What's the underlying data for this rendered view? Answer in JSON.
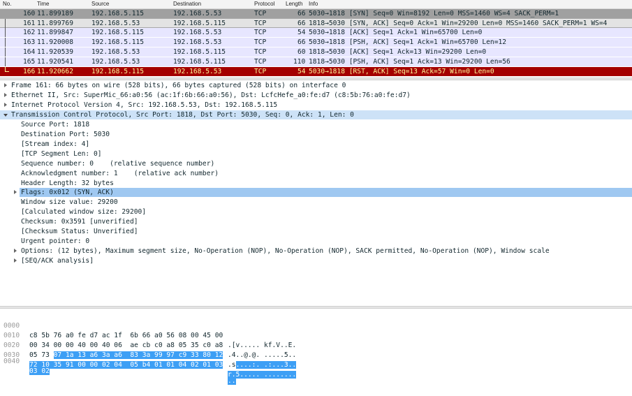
{
  "packet_list": {
    "columns": [
      "No.",
      "Time",
      "Source",
      "Destination",
      "Protocol",
      "Length",
      "Info"
    ],
    "rows": [
      {
        "no": "160",
        "time": "11.899189",
        "src": "192.168.5.115",
        "dst": "192.168.5.53",
        "proto": "TCP",
        "len": "66",
        "info": "5030→1818 [SYN] Seq=0 Win=8192 Len=0 MSS=1460 WS=4 SACK_PERM=1"
      },
      {
        "no": "161",
        "time": "11.899769",
        "src": "192.168.5.53",
        "dst": "192.168.5.115",
        "proto": "TCP",
        "len": "66",
        "info": "1818→5030 [SYN, ACK] Seq=0 Ack=1 Win=29200 Len=0 MSS=1460 SACK_PERM=1 WS=4"
      },
      {
        "no": "162",
        "time": "11.899847",
        "src": "192.168.5.115",
        "dst": "192.168.5.53",
        "proto": "TCP",
        "len": "54",
        "info": "5030→1818 [ACK] Seq=1 Ack=1 Win=65700 Len=0"
      },
      {
        "no": "163",
        "time": "11.920008",
        "src": "192.168.5.115",
        "dst": "192.168.5.53",
        "proto": "TCP",
        "len": "66",
        "info": "5030→1818 [PSH, ACK] Seq=1 Ack=1 Win=65700 Len=12"
      },
      {
        "no": "164",
        "time": "11.920539",
        "src": "192.168.5.53",
        "dst": "192.168.5.115",
        "proto": "TCP",
        "len": "60",
        "info": "1818→5030 [ACK] Seq=1 Ack=13 Win=29200 Len=0"
      },
      {
        "no": "165",
        "time": "11.920541",
        "src": "192.168.5.53",
        "dst": "192.168.5.115",
        "proto": "TCP",
        "len": "110",
        "info": "1818→5030 [PSH, ACK] Seq=1 Ack=13 Win=29200 Len=56"
      },
      {
        "no": "166",
        "time": "11.920662",
        "src": "192.168.5.115",
        "dst": "192.168.5.53",
        "proto": "TCP",
        "len": "54",
        "info": "5030→1818 [RST, ACK] Seq=13 Ack=57 Win=0 Len=0"
      }
    ]
  },
  "details": {
    "frame": "Frame 161: 66 bytes on wire (528 bits), 66 bytes captured (528 bits) on interface 0",
    "ethernet": "Ethernet II, Src: SuperMic_66:a0:56 (ac:1f:6b:66:a0:56), Dst: LcfcHefe_a0:fe:d7 (c8:5b:76:a0:fe:d7)",
    "ip": "Internet Protocol Version 4, Src: 192.168.5.53, Dst: 192.168.5.115",
    "tcp": "Transmission Control Protocol, Src Port: 1818, Dst Port: 5030, Seq: 0, Ack: 1, Len: 0",
    "tcp_fields": {
      "src_port": "Source Port: 1818",
      "dst_port": "Destination Port: 5030",
      "stream_index": "[Stream index: 4]",
      "seg_len": "[TCP Segment Len: 0]",
      "seq": "Sequence number: 0    (relative sequence number)",
      "ack": "Acknowledgment number: 1    (relative ack number)",
      "hdr_len": "Header Length: 32 bytes",
      "flags": "Flags: 0x012 (SYN, ACK)",
      "win_value": "Window size value: 29200",
      "calc_win": "[Calculated window size: 29200]",
      "checksum": "Checksum: 0x3591 [unverified]",
      "checksum_status": "[Checksum Status: Unverified]",
      "urgent": "Urgent pointer: 0",
      "options": "Options: (12 bytes), Maximum segment size, No-Operation (NOP), No-Operation (NOP), SACK permitted, No-Operation (NOP), Window scale",
      "seqack": "[SEQ/ACK analysis]"
    }
  },
  "bytes": {
    "rows": [
      {
        "offset": "0000",
        "hex_plain": "c8 5b 76 a0 fe d7 ac 1f  6b 66 a0 56 08 00 45 00",
        "hex_sel": "",
        "ascii_plain": ".[v..... kf.V..E.",
        "ascii_sel": ""
      },
      {
        "offset": "0010",
        "hex_plain": "00 34 00 00 40 00 40 06  ae cb c0 a8 05 35 c0 a8",
        "hex_sel": "",
        "ascii_plain": ".4..@.@. .....5..",
        "ascii_sel": ""
      },
      {
        "offset": "0020",
        "hex_plain": "05 73 ",
        "hex_sel": "07 1a 13 a6 3a a6  83 3a 99 97 c9 33 80 12",
        "ascii_plain": ".s",
        "ascii_sel": "....:. .:...3.."
      },
      {
        "offset": "0030",
        "hex_plain": "",
        "hex_sel": "72 10 35 91 00 00 02 04  05 b4 01 01 04 02 01 03",
        "ascii_plain": "",
        "ascii_sel": "r.5..... ........"
      },
      {
        "offset": "0040",
        "hex_plain": "",
        "hex_sel": "03 02",
        "ascii_plain": "",
        "ascii_sel": ".."
      }
    ]
  },
  "colors": {
    "syn_row": "#a0a0a0",
    "selected_row": "#e3e3e3",
    "tcp_row": "#e7e6ff",
    "rst_row": "#a40000",
    "rst_text": "#fffc9c",
    "detail_highlight": "#cde2f7",
    "flags_highlight": "#9fc8f1",
    "byte_selection": "#3d9ff5"
  }
}
